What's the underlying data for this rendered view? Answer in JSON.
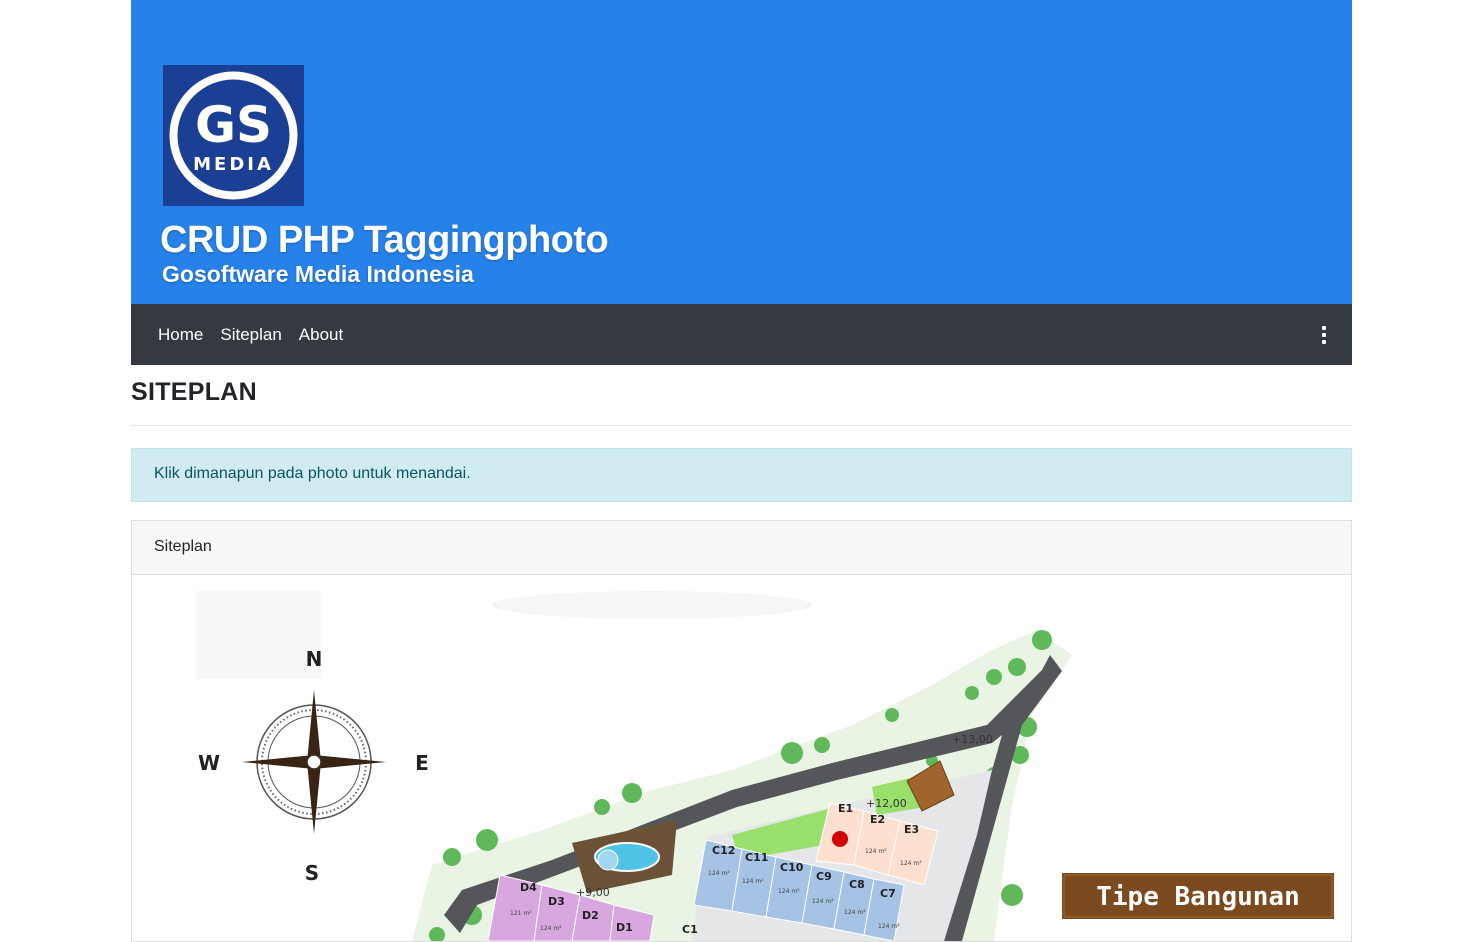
{
  "header": {
    "logo": {
      "line1": "GS",
      "line2": "MEDIA",
      "bg_color": "#1c3f96"
    },
    "title": "CRUD PHP Taggingphoto",
    "subtitle": "Gosoftware Media Indonesia",
    "bg_color": "#2681e8"
  },
  "navbar": {
    "items": [
      {
        "label": "Home"
      },
      {
        "label": "Siteplan"
      },
      {
        "label": "About"
      }
    ],
    "menu_icon": "kebab-vertical-icon",
    "bg_color": "#343a40"
  },
  "page": {
    "title": "SITEPLAN",
    "alert": "Klik dimanapun pada photo untuk menandai.",
    "card_title": "Siteplan"
  },
  "siteplan_image": {
    "compass": {
      "n": "N",
      "s": "S",
      "e": "E",
      "w": "W"
    },
    "elevations": [
      "+13,00",
      "+12,00",
      "+9,00"
    ],
    "lots": [
      "E1",
      "E2",
      "E3",
      "C12",
      "C11",
      "C10",
      "C9",
      "C8",
      "C7",
      "C1",
      "D4",
      "D3",
      "D2",
      "D1"
    ],
    "lot_area": "124 m²",
    "lot_area_small": "121 m²",
    "legend_label": "Tipe Bangunan",
    "marker_color": "#d40000"
  }
}
